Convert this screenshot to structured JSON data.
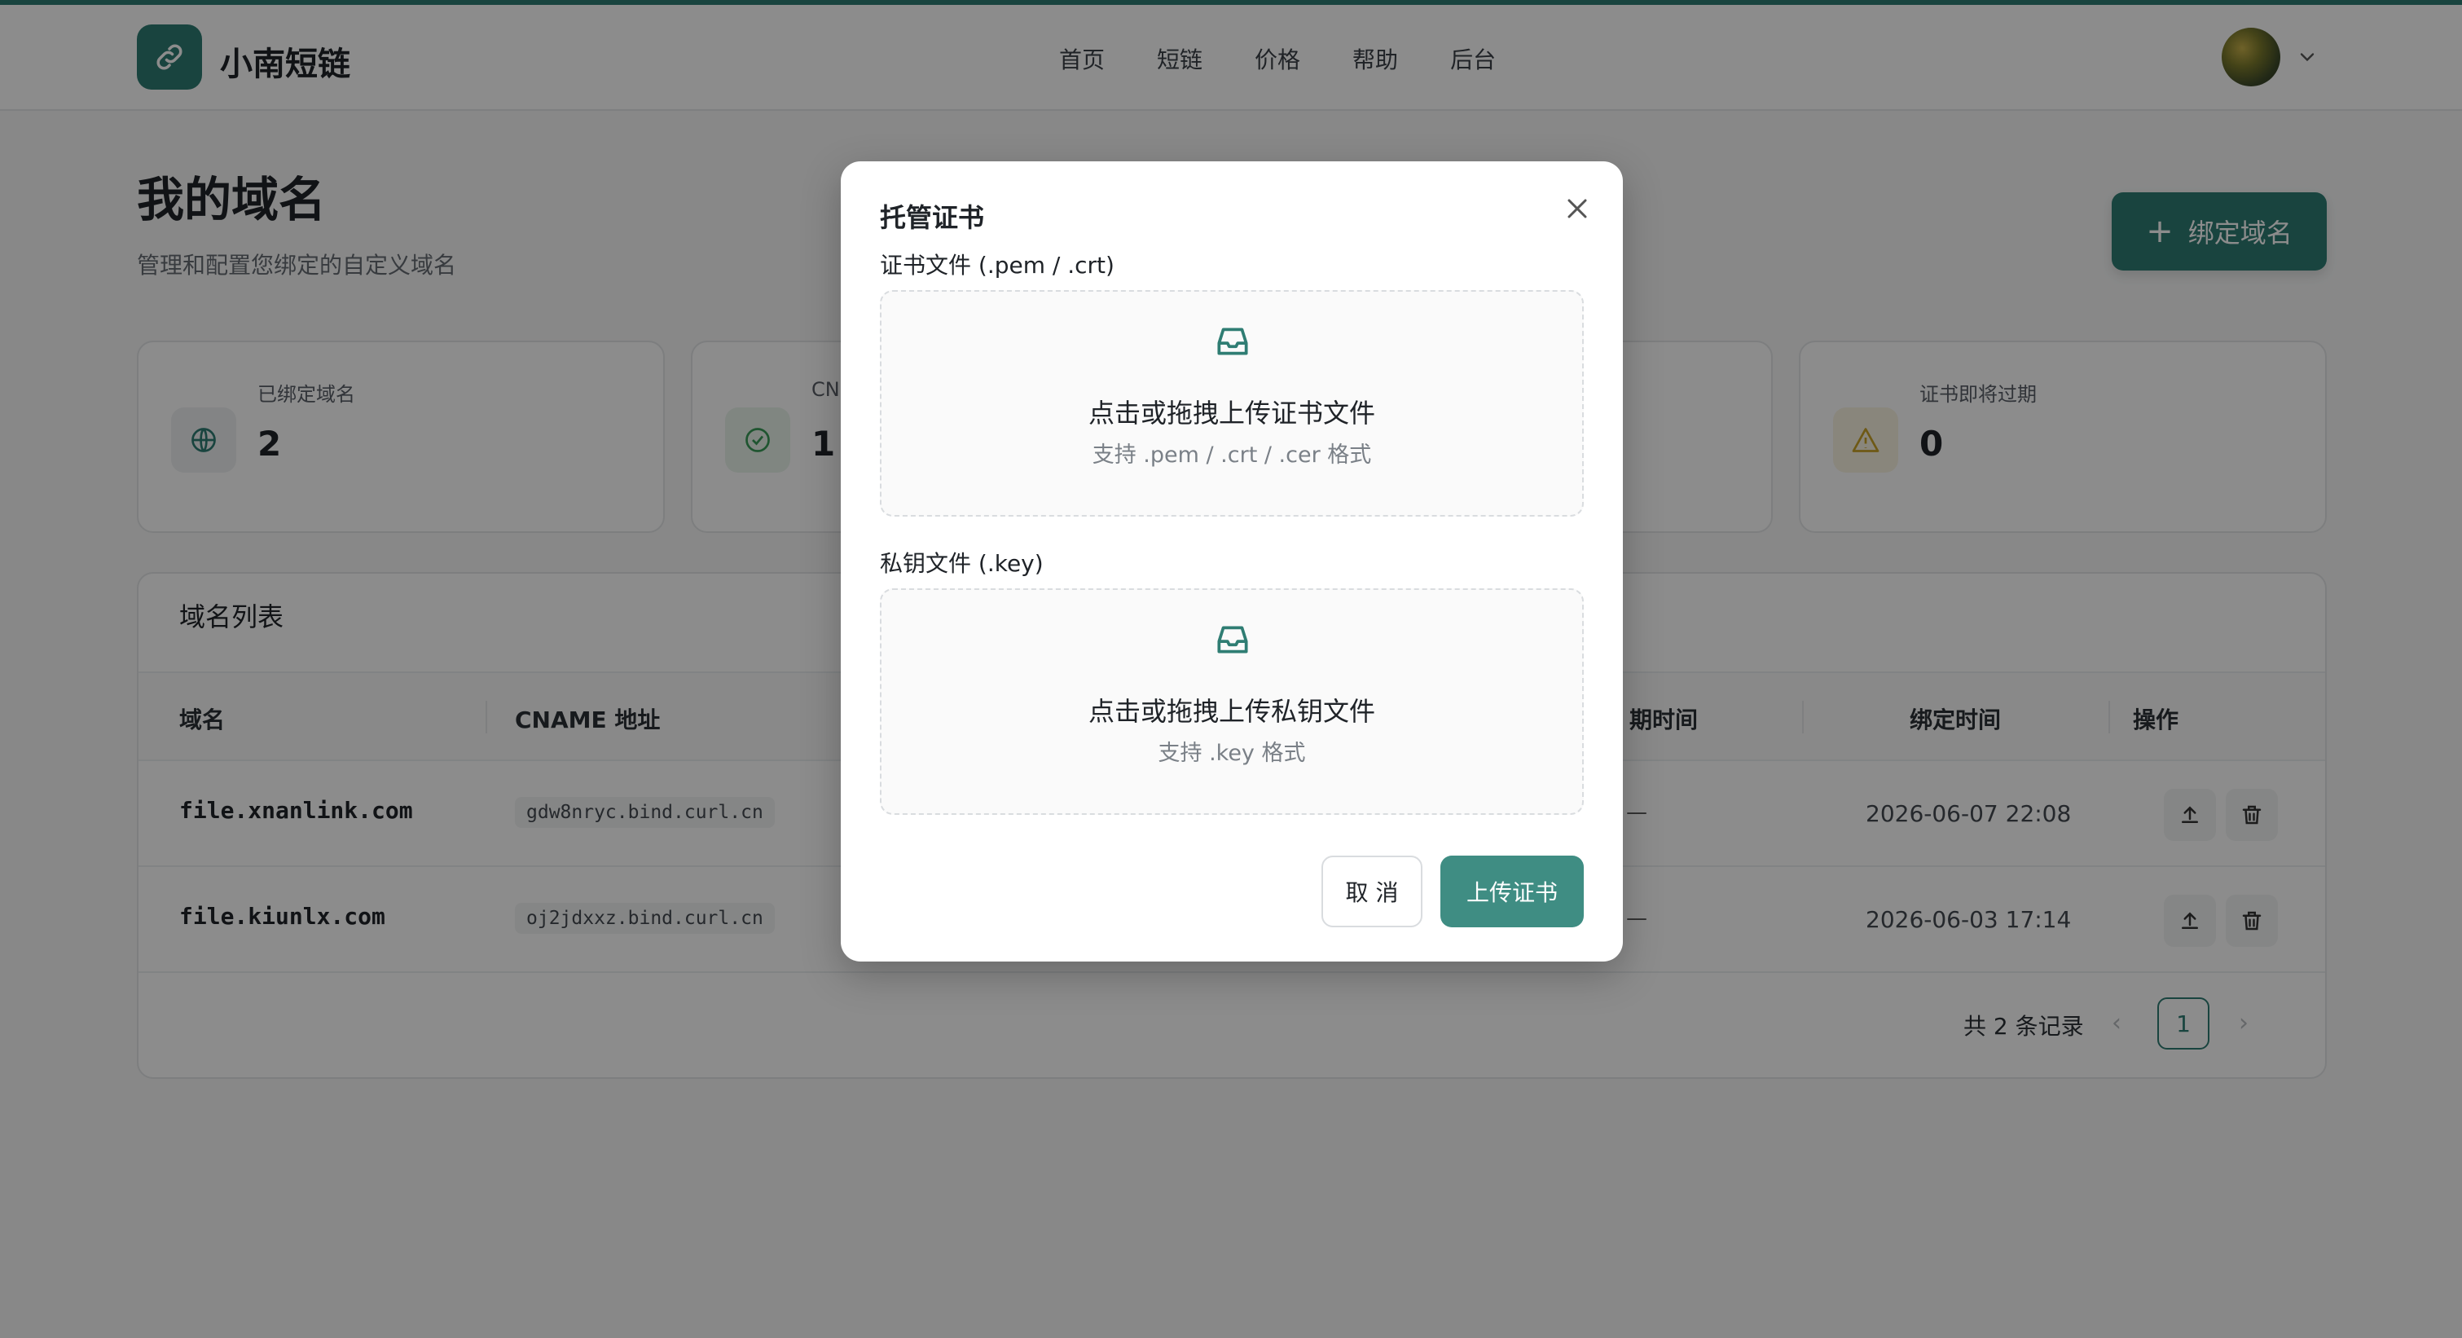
{
  "header": {
    "brand": "小南短链",
    "nav": [
      "首页",
      "短链",
      "价格",
      "帮助",
      "后台"
    ]
  },
  "page": {
    "title": "我的域名",
    "subtitle": "管理和配置您绑定的自定义域名",
    "bind_button": "绑定域名"
  },
  "stats": [
    {
      "label": "已绑定域名",
      "value": "2",
      "icon": "globe-icon"
    },
    {
      "label": "CN",
      "value": "1",
      "icon": "check-circle-icon"
    },
    {
      "label": "证书即将过期",
      "value": "0",
      "icon": "warning-icon"
    }
  ],
  "domain_list": {
    "title": "域名列表",
    "columns": [
      "域名",
      "CNAME 地址",
      "期时间",
      "绑定时间",
      "操作"
    ],
    "rows": [
      {
        "domain": "file.xnanlink.com",
        "cname": "gdw8nryc.bind.curl.cn",
        "expire": "—",
        "bind_time": "2026-06-07 22:08"
      },
      {
        "domain": "file.kiunlx.com",
        "cname": "oj2jdxxz.bind.curl.cn",
        "expire": "—",
        "bind_time": "2026-06-03 17:14"
      }
    ],
    "pager": {
      "total": "共 2 条记录",
      "current": "1",
      "prev": "‹",
      "next": "›"
    }
  },
  "modal": {
    "title": "托管证书",
    "cert": {
      "label": "证书文件 (.pem / .crt)",
      "main": "点击或拖拽上传证书文件",
      "hint": "支持 .pem / .crt / .cer 格式"
    },
    "key": {
      "label": "私钥文件 (.key)",
      "main": "点击或拖拽上传私钥文件",
      "hint": "支持 .key 格式"
    },
    "cancel": "取 消",
    "submit": "上传证书"
  },
  "colors": {
    "accent": "#2f7d73",
    "button": "#3f8d83"
  }
}
